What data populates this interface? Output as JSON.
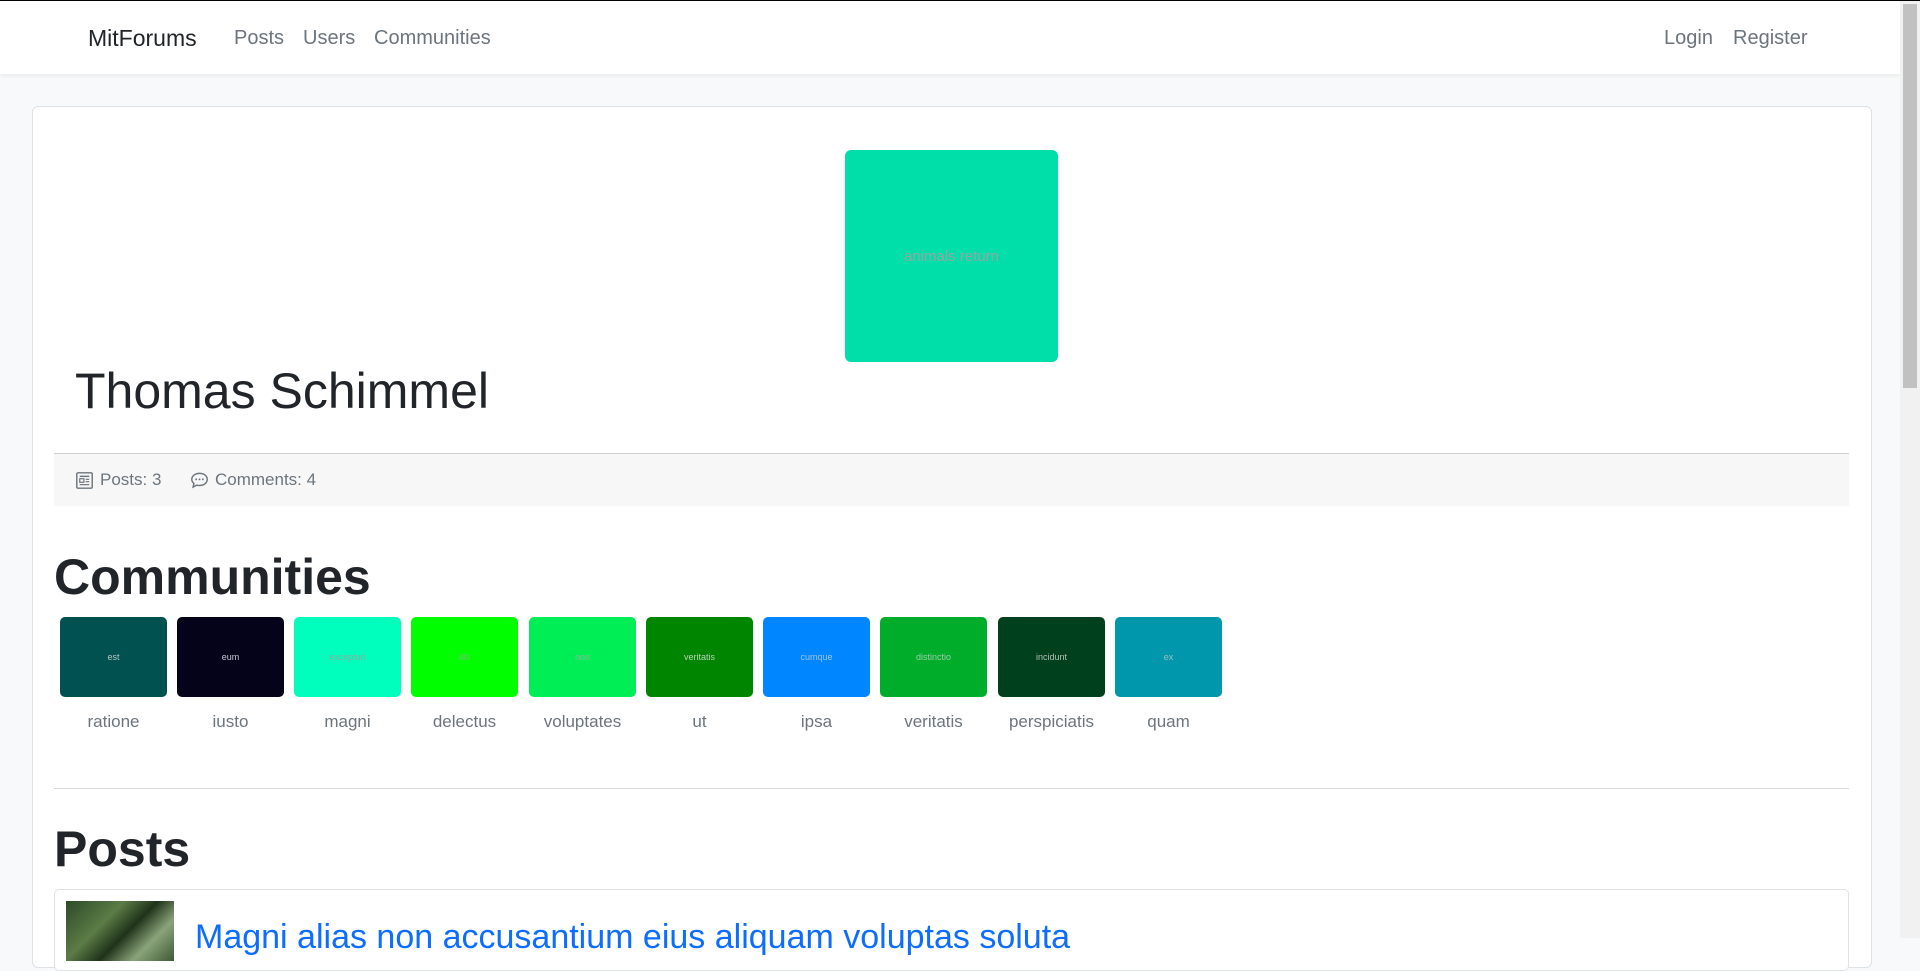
{
  "navbar": {
    "brand": "MitForums",
    "links": [
      "Posts",
      "Users",
      "Communities"
    ],
    "auth": [
      "Login",
      "Register"
    ]
  },
  "profile": {
    "avatar_text": "animals return",
    "avatar_color": "#00dfa9",
    "name": "Thomas Schimmel",
    "posts_label": "Posts: 3",
    "comments_label": "Comments: 4"
  },
  "communities": {
    "title": "Communities",
    "items": [
      {
        "tile_text": "est",
        "name": "ratione",
        "color": "#00514f",
        "text_color": "#b8c6c5"
      },
      {
        "tile_text": "eum",
        "name": "iusto",
        "color": "#04031a",
        "text_color": "#c9c9d2"
      },
      {
        "tile_text": "excepturi",
        "name": "magni",
        "color": "#00ffbd",
        "text_color": "#8ea9a0"
      },
      {
        "tile_text": "illo",
        "name": "delectus",
        "color": "#00fe00",
        "text_color": "#7fb87f"
      },
      {
        "tile_text": "non",
        "name": "voluptates",
        "color": "#00ee55",
        "text_color": "#8ab49a"
      },
      {
        "tile_text": "veritatis",
        "name": "ut",
        "color": "#008500",
        "text_color": "#b7d2b7"
      },
      {
        "tile_text": "cumque",
        "name": "ipsa",
        "color": "#0087ff",
        "text_color": "#9ec3e3"
      },
      {
        "tile_text": "distinctio",
        "name": "veritatis",
        "color": "#00ad2b",
        "text_color": "#9fcaa9"
      },
      {
        "tile_text": "incidunt",
        "name": "perspiciatis",
        "color": "#00401c",
        "text_color": "#b0c0b6"
      },
      {
        "tile_text": "ex",
        "name": "quam",
        "color": "#0096ab",
        "text_color": "#9cbfc4"
      }
    ]
  },
  "posts": {
    "title": "Posts",
    "items": [
      {
        "title": "Magni alias non accusantium eius aliquam voluptas soluta"
      }
    ]
  }
}
